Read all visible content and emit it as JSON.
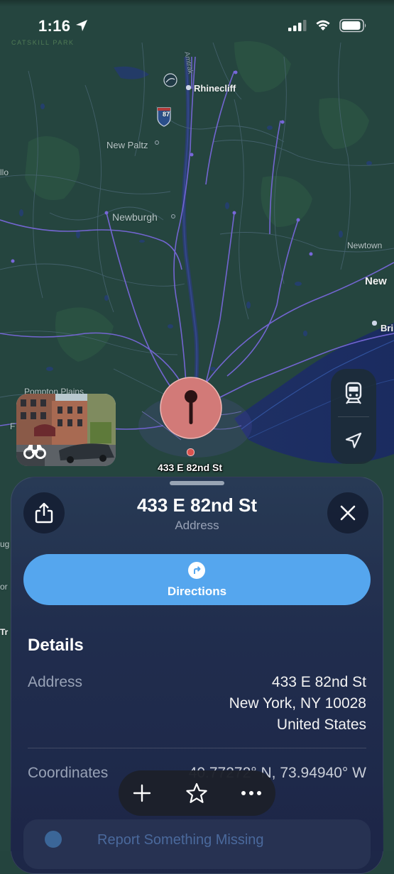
{
  "status_bar": {
    "time": "1:16"
  },
  "map": {
    "park_label": "CATSKILL PARK",
    "highway_shield": "87",
    "labels": {
      "rhinecliff": "Rhinecliff",
      "new_paltz": "New Paltz",
      "newburgh": "Newburgh",
      "newtown": "Newtown",
      "new_edge": "New",
      "bri_edge": "Bri",
      "left_edge_1": "llo",
      "pompton_plains": "Pompton Plains",
      "left_edge_f": "F",
      "left_edge_ug": "ug",
      "left_edge_or": "or",
      "left_edge_tr": "Tr",
      "river": "Amtrak"
    },
    "pin_label": "433 E 82nd St",
    "controls": {
      "transit_icon": "tram-icon",
      "location_icon": "location-arrow-icon"
    }
  },
  "sheet": {
    "title": "433 E 82nd St",
    "subtitle": "Address",
    "directions_label": "Directions",
    "details_heading": "Details",
    "address_label": "Address",
    "address_lines": [
      "433 E 82nd St",
      "New York, NY  10028",
      "United States"
    ],
    "coordinates_label": "Coordinates",
    "coordinates_value": "40.77272° N, 73.94940° W",
    "report_label": "Report Something Missing"
  },
  "colors": {
    "accent": "#55a6ee",
    "pin": "#e07a78",
    "map_bg": "#24443e",
    "roads": "#7d6fd6"
  }
}
